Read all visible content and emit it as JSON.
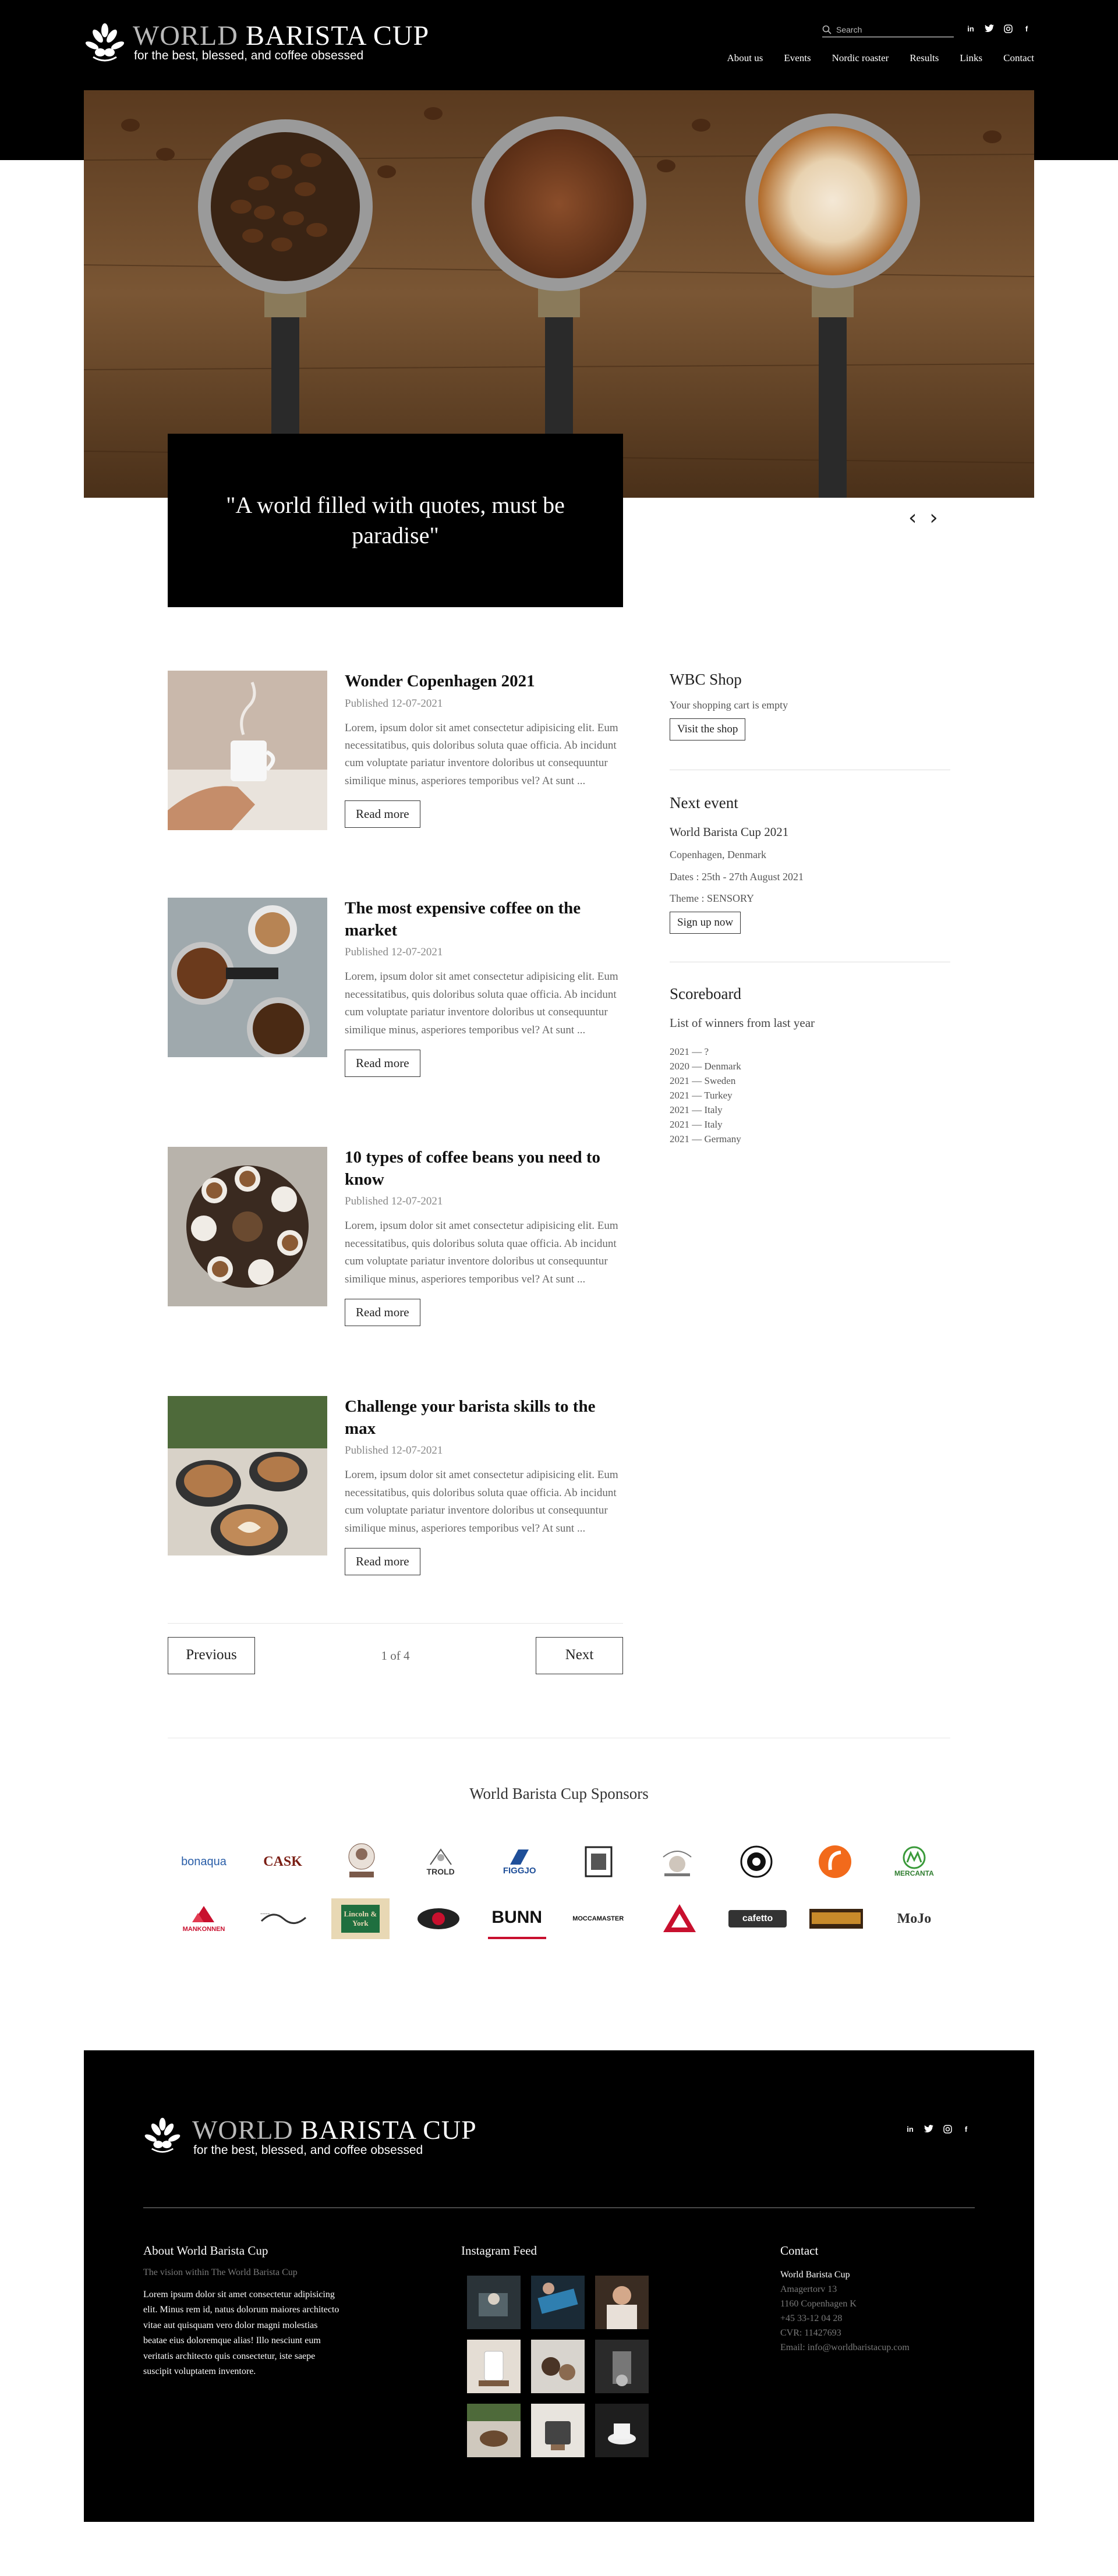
{
  "brand": {
    "name_part1": "WORLD ",
    "name_part2": "BARISTA CUP",
    "tagline": "for the best, blessed, and coffee obsessed"
  },
  "search": {
    "placeholder": "Search"
  },
  "social": [
    "linkedin-icon",
    "twitter-icon",
    "instagram-icon",
    "facebook-icon"
  ],
  "nav": [
    "About us",
    "Events",
    "Nordic roaster",
    "Results",
    "Links",
    "Contact"
  ],
  "hero": {
    "quote": "\"A world filled with quotes, must be paradise\"",
    "prev": "‹",
    "next": "›"
  },
  "posts": [
    {
      "title": "Wonder Copenhagen 2021",
      "date": "Published 12-07-2021",
      "excerpt": "Lorem, ipsum dolor sit amet consectetur adipisicing elit. Eum necessitatibus, quis doloribus soluta quae officia. Ab incidunt cum voluptate pariatur inventore doloribus ut consequuntur similique minus, asperiores temporibus vel? At sunt ...",
      "button": "Read more"
    },
    {
      "title": "The most expensive coffee on the market",
      "date": "Published 12-07-2021",
      "excerpt": "Lorem, ipsum dolor sit amet consectetur adipisicing elit. Eum necessitatibus, quis doloribus soluta quae officia. Ab incidunt cum voluptate pariatur inventore doloribus ut consequuntur similique minus, asperiores temporibus vel? At sunt ...",
      "button": "Read more"
    },
    {
      "title": "10 types of coffee beans you need to know",
      "date": "Published 12-07-2021",
      "excerpt": "Lorem, ipsum dolor sit amet consectetur adipisicing elit. Eum necessitatibus, quis doloribus soluta quae officia. Ab incidunt cum voluptate pariatur inventore doloribus ut consequuntur similique minus, asperiores temporibus vel? At sunt ...",
      "button": "Read more"
    },
    {
      "title": "Challenge your barista skills to the max",
      "date": "Published 12-07-2021",
      "excerpt": "Lorem, ipsum dolor sit amet consectetur adipisicing elit. Eum necessitatibus, quis doloribus soluta quae officia. Ab incidunt cum voluptate pariatur inventore doloribus ut consequuntur similique minus, asperiores temporibus vel? At sunt ...",
      "button": "Read more"
    }
  ],
  "pager": {
    "previous": "Previous",
    "info": "1 of 4",
    "next": "Next"
  },
  "shop": {
    "title": "WBC Shop",
    "cart": "Your shopping cart is empty",
    "button": "Visit the shop"
  },
  "event": {
    "title": "Next event",
    "name": "World Barista Cup 2021",
    "location": "Copenhagen, Denmark",
    "dates": "Dates : 25th - 27th August 2021",
    "theme": "Theme : SENSORY",
    "button": "Sign up now"
  },
  "scoreboard": {
    "title": "Scoreboard",
    "subtitle": "List of winners from last year",
    "winners": [
      "2021 — ?",
      "2020 — Denmark",
      "2021 — Sweden",
      "2021 — Turkey",
      "2021 — Italy",
      "2021 — Italy",
      "2021 — Germany"
    ]
  },
  "sponsors": {
    "title": "World Barista Cup Sponsors",
    "row1": [
      "bonaqua",
      "CASK",
      "",
      "TROLD",
      "FIGGJO",
      "",
      "",
      "",
      "",
      "MERCANTA"
    ],
    "row2": [
      "MANKONNEN",
      "",
      "Lincoln & York",
      "",
      "BUNN",
      "MOCCAMASTER",
      "",
      "cafetto",
      "",
      "MoJo"
    ]
  },
  "footer": {
    "about": {
      "title": "About World Barista Cup",
      "sub": "The vision within The World Barista Cup",
      "text": "Lorem ipsum dolor sit amet consectetur adipisicing elit. Minus rem id, natus dolorum maiores architecto vitae aut quisquam vero dolor magni molestias beatae eius doloremque alias! Illo nesciunt eum veritatis architecto quis consectetur, iste saepe suscipit voluptatem inventore."
    },
    "instagram": {
      "title": "Instagram Feed"
    },
    "contact": {
      "title": "Contact",
      "name": "World Barista Cup",
      "street": "Amagertorv 13",
      "city": "1160 Copenhagen K",
      "phone": "+45 33-12 04 28",
      "cvr": "CVR: 11427693",
      "email": "Email: info@worldbaristacup.com"
    }
  },
  "colors": {
    "black": "#000000",
    "white": "#ffffff",
    "muted": "#7a7a7a"
  }
}
